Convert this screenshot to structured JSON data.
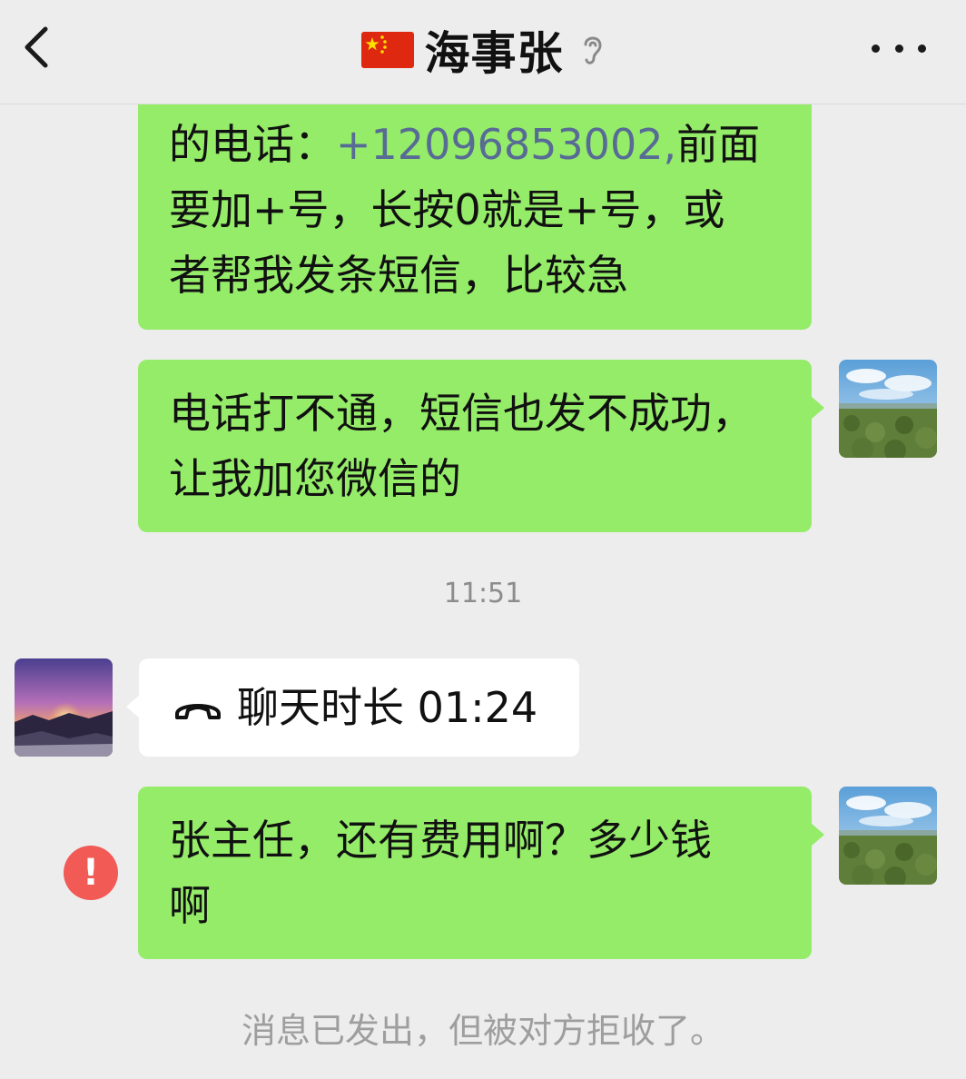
{
  "header": {
    "back_icon": "chevron-left-icon",
    "flag_icon": "china-flag-icon",
    "title": "海事张",
    "ear_icon": "ear-icon",
    "more_icon": "more-dots-icon"
  },
  "messages": {
    "msg1": {
      "line1_prefix": "的电话：",
      "line1_phone": "+12096853002,",
      "line1_suffix": "前面",
      "line2": "要加+号，长按0就是+号，或",
      "line3": "者帮我发条短信，比较急"
    },
    "msg2": {
      "line1": "电话打不通，短信也发不成功，",
      "line2": "让我加您微信的"
    },
    "timestamp": "11:51",
    "call": {
      "icon": "phone-hangup-icon",
      "text": "聊天时长 01:24"
    },
    "msg3": {
      "line1": "张主任，还有费用啊？多少钱",
      "line2": "啊"
    },
    "error_badge": "!",
    "system_notice": "消息已发出，但被对方拒收了。"
  },
  "colors": {
    "background": "#ededed",
    "bubble_self": "#95ec69",
    "bubble_other": "#ffffff",
    "link": "#576b95",
    "error": "#f25a56",
    "muted_text": "#9e9e9e"
  }
}
